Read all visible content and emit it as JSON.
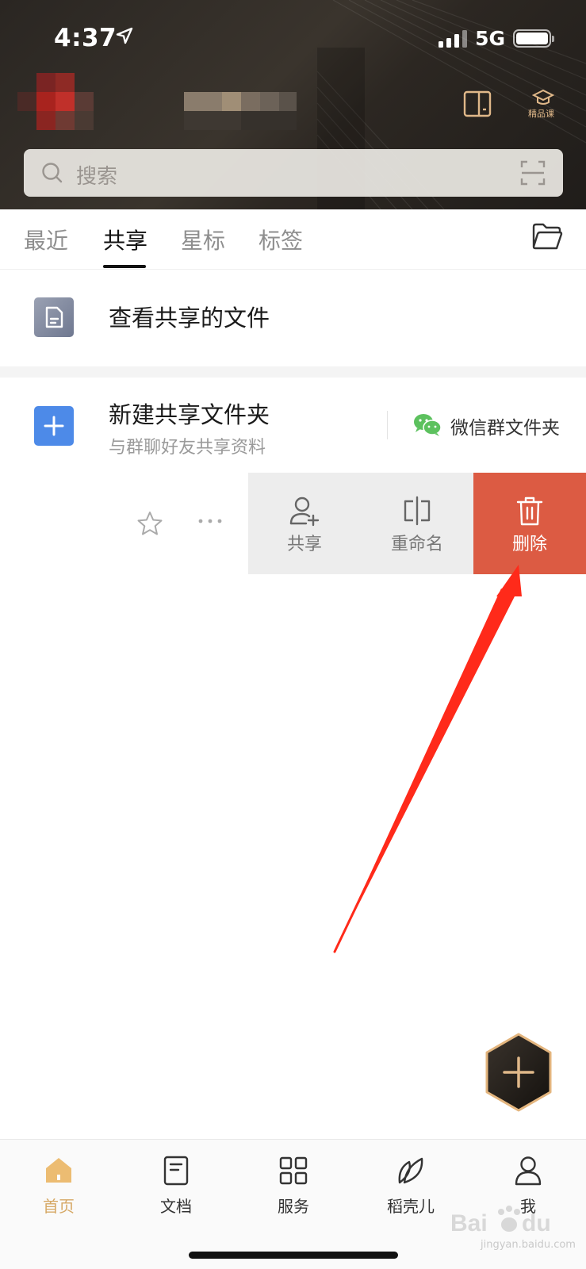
{
  "status_bar": {
    "time": "4:37",
    "network": "5G"
  },
  "header": {
    "course_label": "精品课",
    "accent_color": "#e0b889"
  },
  "search": {
    "placeholder": "搜索"
  },
  "tabs": [
    {
      "label": "最近",
      "active": false
    },
    {
      "label": "共享",
      "active": true
    },
    {
      "label": "星标",
      "active": false
    },
    {
      "label": "标签",
      "active": false
    }
  ],
  "list": {
    "view_shared": {
      "title": "查看共享的文件",
      "icon": "document-icon"
    },
    "new_shared": {
      "title": "新建共享文件夹",
      "subtitle": "与群聊好友共享资料",
      "wechat_label": "微信群文件夹"
    }
  },
  "swipe_actions": [
    {
      "label": "共享",
      "icon": "add-user-icon"
    },
    {
      "label": "重命名",
      "icon": "rename-icon"
    },
    {
      "label": "删除",
      "icon": "trash-icon",
      "color": "#dc5b43"
    }
  ],
  "bottom_nav": [
    {
      "label": "首页",
      "icon": "home-icon",
      "active": true
    },
    {
      "label": "文档",
      "icon": "document-icon",
      "active": false
    },
    {
      "label": "服务",
      "icon": "grid-icon",
      "active": false
    },
    {
      "label": "稻壳儿",
      "icon": "leaf-icon",
      "active": false
    },
    {
      "label": "我",
      "icon": "user-icon",
      "active": false
    }
  ],
  "watermark": {
    "text": "jingyan.baidu.com"
  },
  "colors": {
    "active_nav": "#d6a865",
    "primary_blue": "#4d8ae8",
    "wechat_green": "#5cc15e"
  }
}
